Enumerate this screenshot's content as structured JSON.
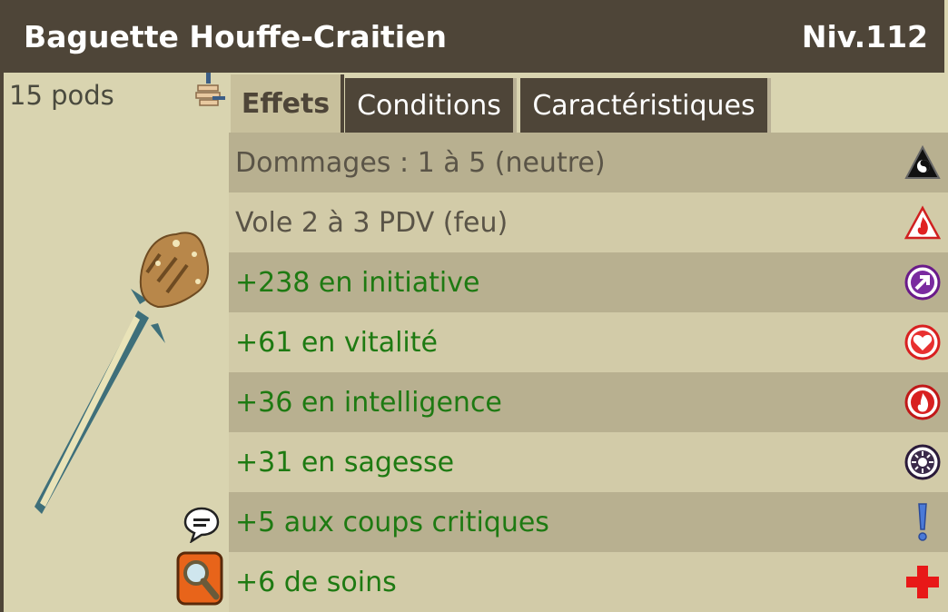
{
  "item": {
    "name": "Baguette Houffe-Craitien",
    "level": "Niv.112",
    "weight": "15 pods"
  },
  "tabs": [
    {
      "label": "Effets",
      "active": true
    },
    {
      "label": "Conditions",
      "active": false
    },
    {
      "label": "Caractéristiques",
      "active": false
    }
  ],
  "effects": [
    {
      "text": "Dommages : 1 à 5 (neutre)",
      "icon": "neutral-element-icon",
      "kind": "neutral"
    },
    {
      "text": "Vole 2 à 3 PDV (feu)",
      "icon": "fire-element-icon",
      "kind": "neutral"
    },
    {
      "text": "+238 en initiative",
      "icon": "initiative-icon",
      "kind": "bonus"
    },
    {
      "text": "+61 en vitalité",
      "icon": "vitality-heart-icon",
      "kind": "bonus"
    },
    {
      "text": "+36 en intelligence",
      "icon": "intelligence-flame-icon",
      "kind": "bonus"
    },
    {
      "text": "+31 en sagesse",
      "icon": "wisdom-icon",
      "kind": "bonus"
    },
    {
      "text": "+5 aux coups critiques",
      "icon": "critical-exclamation-icon",
      "kind": "bonus"
    },
    {
      "text": "+6 de soins",
      "icon": "heal-cross-icon",
      "kind": "bonus"
    }
  ],
  "colors": {
    "header": "#4e4538",
    "bonus_text": "#1e7a12",
    "neutral_text": "#5a5447",
    "row_dark": "#b8b090",
    "row_light": "#d2cba8"
  }
}
